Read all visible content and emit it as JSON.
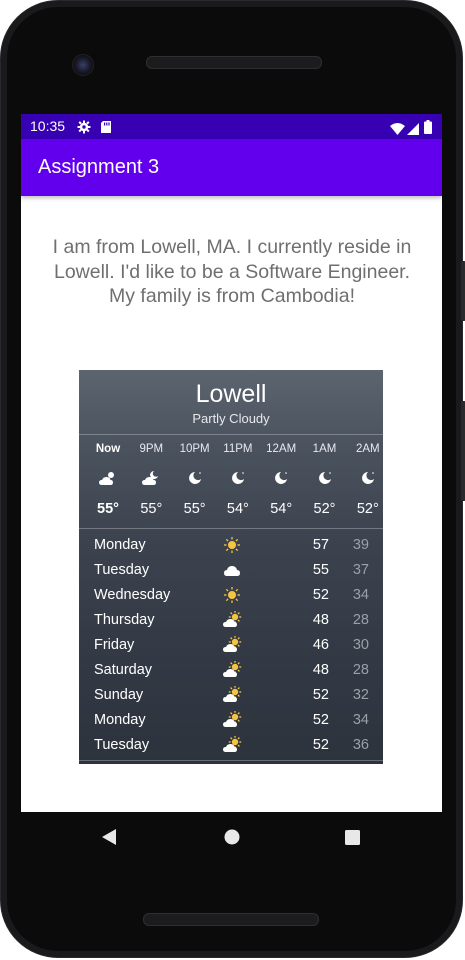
{
  "status_bar": {
    "time": "10:35",
    "icons": [
      "gear-icon",
      "sd-card-icon",
      "wifi-icon",
      "signal-icon",
      "battery-icon"
    ]
  },
  "app_bar": {
    "title": "Assignment 3"
  },
  "intro": {
    "text": "I am from Lowell, MA. I currently reside in Lowell. I'd like to be a Software Engineer. My family is from Cambodia!"
  },
  "weather": {
    "city": "Lowell",
    "condition": "Partly Cloudy",
    "hourly": [
      {
        "label": "Now",
        "icon": "cloud-sun-icon",
        "temp": "55°"
      },
      {
        "label": "9PM",
        "icon": "cloud-moon-icon",
        "temp": "55°"
      },
      {
        "label": "10PM",
        "icon": "moon-icon",
        "temp": "55°"
      },
      {
        "label": "11PM",
        "icon": "moon-icon",
        "temp": "54°"
      },
      {
        "label": "12AM",
        "icon": "moon-icon",
        "temp": "54°"
      },
      {
        "label": "1AM",
        "icon": "moon-icon",
        "temp": "52°"
      },
      {
        "label": "2AM",
        "icon": "moon-icon",
        "temp": "52°"
      }
    ],
    "daily": [
      {
        "day": "Monday",
        "icon": "sun-icon",
        "high": "57",
        "low": "39"
      },
      {
        "day": "Tuesday",
        "icon": "cloud-icon",
        "high": "55",
        "low": "37"
      },
      {
        "day": "Wednesday",
        "icon": "sun-icon",
        "high": "52",
        "low": "34"
      },
      {
        "day": "Thursday",
        "icon": "partly-sunny-icon",
        "high": "48",
        "low": "28"
      },
      {
        "day": "Friday",
        "icon": "partly-sunny-icon",
        "high": "46",
        "low": "30"
      },
      {
        "day": "Saturday",
        "icon": "partly-sunny-icon",
        "high": "48",
        "low": "28"
      },
      {
        "day": "Sunday",
        "icon": "partly-sunny-icon",
        "high": "52",
        "low": "32"
      },
      {
        "day": "Monday",
        "icon": "partly-sunny-icon",
        "high": "52",
        "low": "34"
      },
      {
        "day": "Tuesday",
        "icon": "partly-sunny-icon",
        "high": "52",
        "low": "36"
      }
    ]
  },
  "navigation": {
    "buttons": [
      "back-icon",
      "home-icon",
      "recents-icon"
    ]
  },
  "colors": {
    "status_bar": "#3700b3",
    "app_bar": "#6200ee",
    "intro_text": "#6f6f6f",
    "sun": "#f5c542"
  }
}
